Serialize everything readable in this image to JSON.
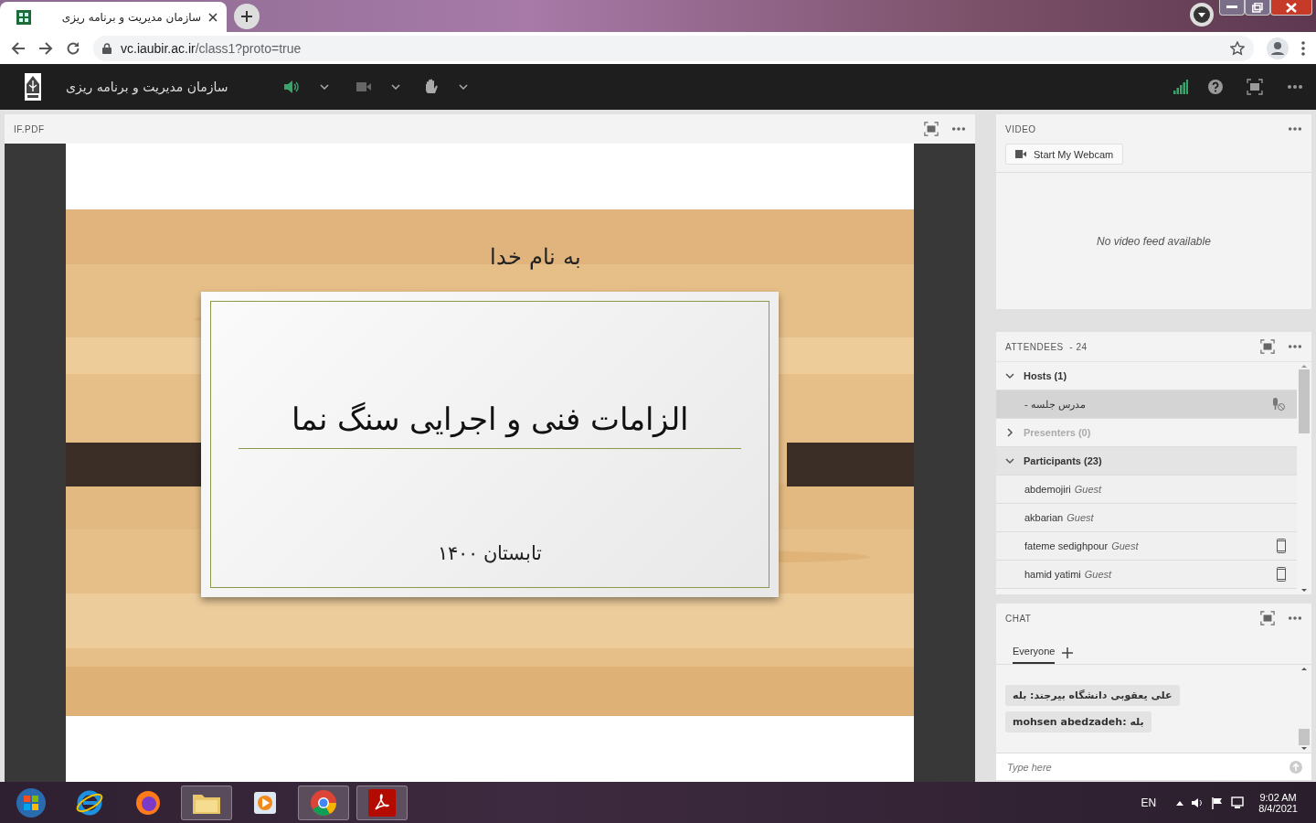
{
  "browser": {
    "tab_title": "سازمان مدیریت و برنامه ریزی",
    "url_host": "vc.iaubir.ac.ir",
    "url_path": "/class1?proto=true"
  },
  "app": {
    "title": "سازمان مدیریت و برنامه ریزی",
    "speaker_on": true
  },
  "share_pod": {
    "title": "IF.PDF"
  },
  "slide": {
    "heading": "به نام خدا",
    "title": "الزامات فنی و اجرایی سنگ نما",
    "subtitle": "تابستان ۱۴۰۰"
  },
  "video": {
    "title": "VIDEO",
    "button": "Start My Webcam",
    "message": "No video feed available"
  },
  "attendees": {
    "title": "ATTENDEES  - 24",
    "groups": [
      {
        "label": "Hosts (1)",
        "expanded": true,
        "disabled": false,
        "highlighted": false,
        "members": [
          {
            "name": "مدرس جلسه -",
            "mic_muted": true,
            "on_mobile": false,
            "highlighted": true
          }
        ]
      },
      {
        "label": "Presenters (0)",
        "expanded": false,
        "disabled": true,
        "highlighted": false
      },
      {
        "label": "Participants (23)",
        "expanded": true,
        "disabled": false,
        "highlighted": true,
        "members": [
          {
            "name": "abdemojiri",
            "role": "Guest",
            "mic_muted": false,
            "on_mobile": false,
            "highlighted": false
          },
          {
            "name": "akbarian",
            "role": "Guest",
            "mic_muted": false,
            "on_mobile": false,
            "highlighted": false
          },
          {
            "name": "fateme sedighpour",
            "role": "Guest",
            "mic_muted": false,
            "on_mobile": true,
            "highlighted": false
          },
          {
            "name": "hamid yatimi",
            "role": "Guest",
            "mic_muted": false,
            "on_mobile": true,
            "highlighted": false
          }
        ]
      }
    ]
  },
  "chat": {
    "title": "CHAT",
    "tabs": [
      {
        "label": "Everyone",
        "selected": true
      }
    ],
    "messages": [
      {
        "text": "علی یعقوبی دانشگاه بیرجند: بله"
      },
      {
        "text": "mohsen abedzadeh: بله"
      }
    ],
    "placeholder": "Type here"
  },
  "taskbar": {
    "language": "EN",
    "time": "9:02 AM",
    "date": "8/4/2021"
  }
}
